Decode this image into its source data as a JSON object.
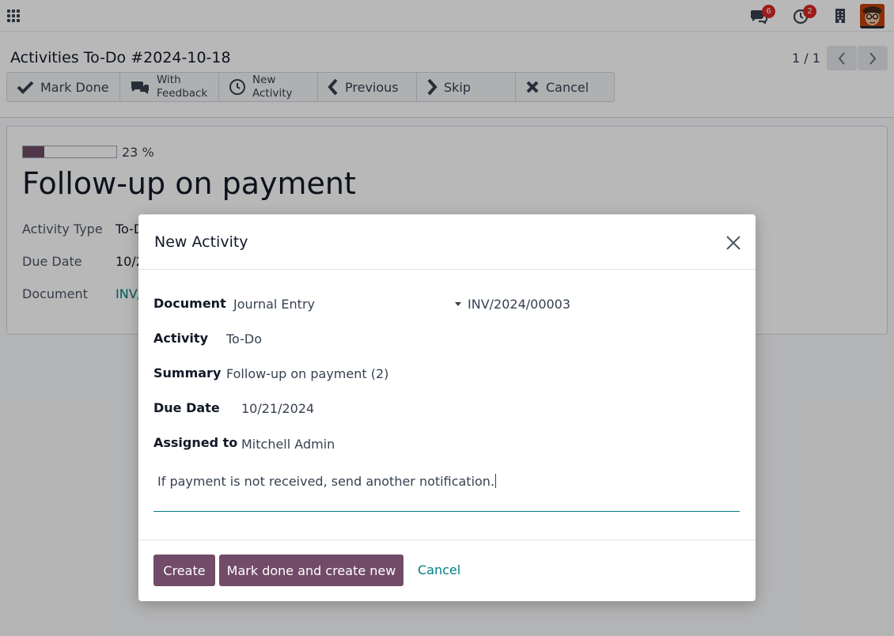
{
  "navbar": {
    "messages_count": "6",
    "activities_count": "2"
  },
  "control_panel": {
    "breadcrumb": "Activities To-Do #2024-10-18",
    "pager": "1 / 1",
    "actions": [
      {
        "label": "Mark Done",
        "icon": "check-icon"
      },
      {
        "label": "With Feedback",
        "icon": "comments-icon"
      },
      {
        "label": "New Activity",
        "icon": "clock-icon"
      },
      {
        "label": "Previous",
        "icon": "chevron-left-icon"
      },
      {
        "label": "Skip",
        "icon": "chevron-right-icon"
      },
      {
        "label": "Cancel",
        "icon": "close-icon"
      }
    ]
  },
  "form": {
    "progress_label": "23 %",
    "progress_value": 0.23,
    "title": "Follow-up on payment",
    "fields": [
      {
        "label": "Activity Type",
        "value": "To-D"
      },
      {
        "label": "Due Date",
        "value": "10/2"
      },
      {
        "label": "Document",
        "value": "INV/"
      }
    ]
  },
  "modal": {
    "title": "New Activity",
    "fields": {
      "document_label": "Document",
      "document_model": "Journal Entry",
      "document_record": "INV/2024/00003",
      "activity_label": "Activity",
      "activity_value": "To-Do",
      "summary_label": "Summary",
      "summary_value": "Follow-up on payment (2)",
      "due_date_label": "Due Date",
      "due_date_value": "10/21/2024",
      "assigned_label": "Assigned to",
      "assigned_value": "Mitchell Admin"
    },
    "note": "If payment is not received, send another notification.",
    "buttons": {
      "create": "Create",
      "mark_done_create_new": "Mark done and create new",
      "cancel": "Cancel"
    }
  },
  "colors": {
    "brand": "#714b67",
    "link": "#017e84",
    "badge": "#dc2626"
  }
}
